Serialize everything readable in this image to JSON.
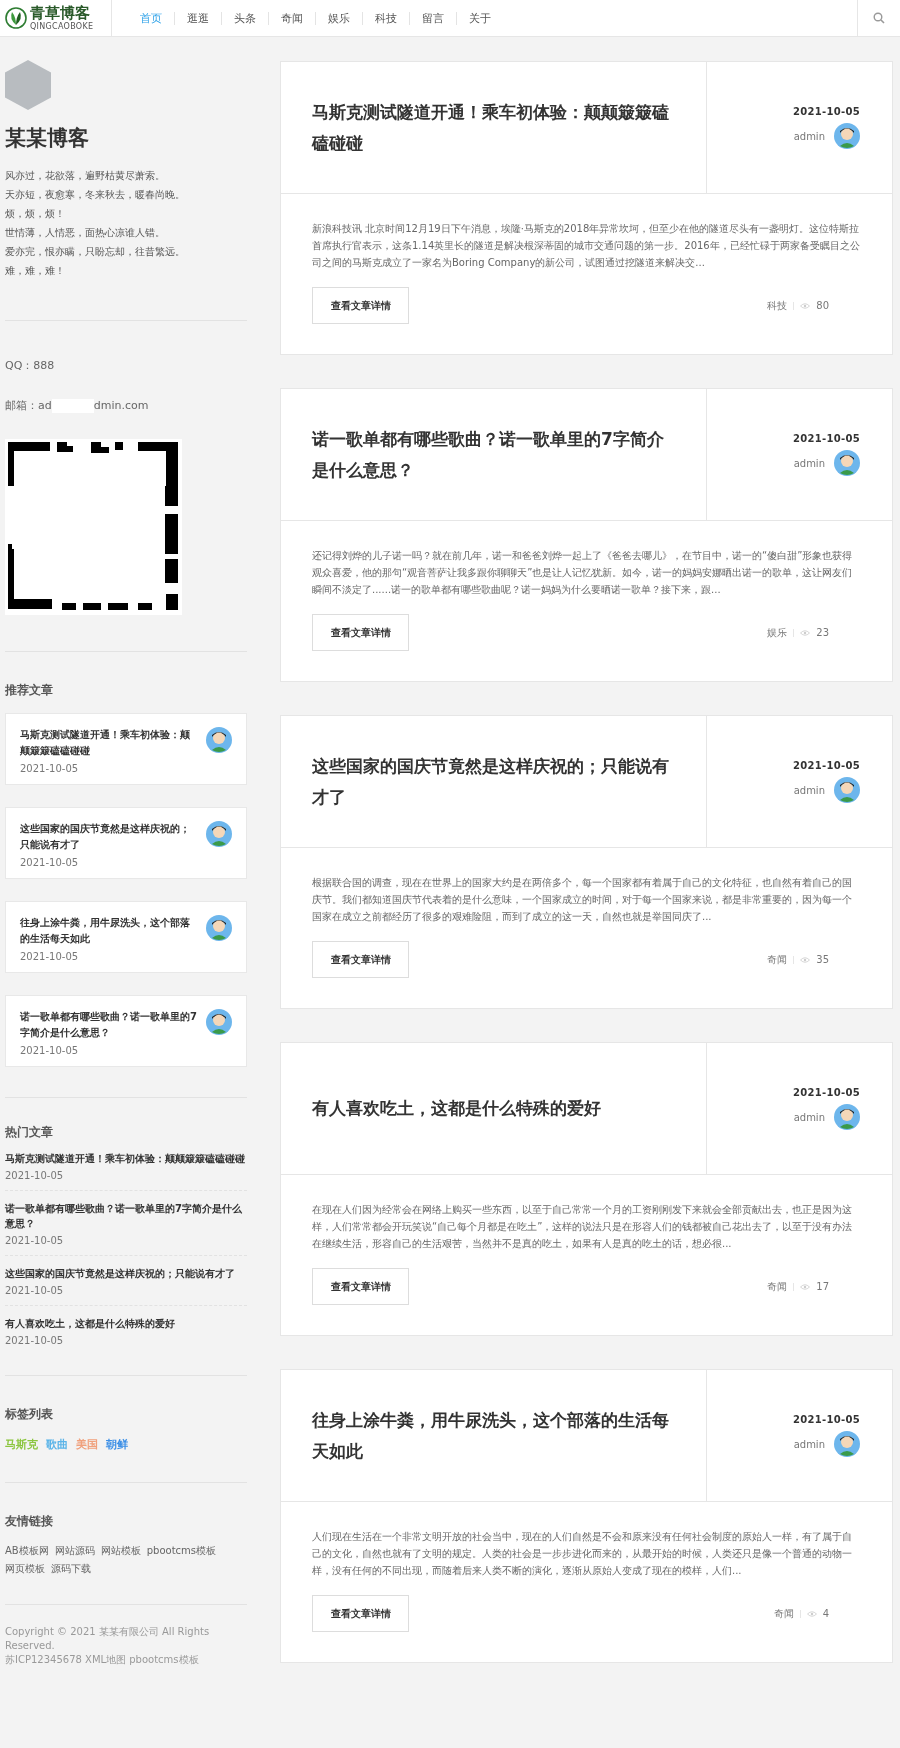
{
  "header": {
    "logo_text": "青草博客",
    "logo_sub": "QINGCAOBOKE",
    "nav": [
      {
        "label": "首页",
        "selected": true
      },
      {
        "label": "逛逛",
        "selected": false
      },
      {
        "label": "头条",
        "selected": false
      },
      {
        "label": "奇闻",
        "selected": false
      },
      {
        "label": "娱乐",
        "selected": false
      },
      {
        "label": "科技",
        "selected": false
      },
      {
        "label": "留言",
        "selected": false
      },
      {
        "label": "关于",
        "selected": false
      }
    ]
  },
  "sidebar": {
    "blog_title": "某某博客",
    "bio": [
      "风亦过，花欲落，遍野枯黄尽萧索。",
      "天亦短，夜愈寒，冬来秋去，暖春尚晚。",
      "烦，烦，烦！",
      "世情薄，人情恶，面热心凉谁人错。",
      "爱亦完，恨亦瞒，只盼忘却，往昔繁远。",
      "难，难，难！"
    ],
    "qq": "QQ：888",
    "email": [
      "邮箱：ad",
      "dmin.com"
    ],
    "recommended": {
      "heading": "推荐文章",
      "items": [
        {
          "title": "马斯克测试隧道开通！乘车初体验：颠颠簸簸磕磕碰碰",
          "date": "2021-10-05"
        },
        {
          "title": "这些国家的国庆节竟然是这样庆祝的；只能说有才了",
          "date": "2021-10-05"
        },
        {
          "title": "往身上涂牛粪，用牛尿洗头，这个部落的生活每天如此",
          "date": "2021-10-05"
        },
        {
          "title": "诺一歌单都有哪些歌曲？诺一歌单里的7字简介是什么意思？",
          "date": "2021-10-05"
        }
      ]
    },
    "hot": {
      "heading": "热门文章",
      "items": [
        {
          "title": "马斯克测试隧道开通！乘车初体验：颠颠簸簸磕磕碰碰",
          "date": "2021-10-05"
        },
        {
          "title": "诺一歌单都有哪些歌曲？诺一歌单里的7字简介是什么意思？",
          "date": "2021-10-05"
        },
        {
          "title": "这些国家的国庆节竟然是这样庆祝的；只能说有才了",
          "date": "2021-10-05"
        },
        {
          "title": "有人喜欢吃土，这都是什么特殊的爱好",
          "date": "2021-10-05"
        }
      ]
    },
    "tags": {
      "heading": "标签列表",
      "items": [
        {
          "label": "马斯克",
          "color": "#8cc63f"
        },
        {
          "label": "歌曲",
          "color": "#5bb4e8"
        },
        {
          "label": "美国",
          "color": "#f0a07c"
        },
        {
          "label": "朝鲜",
          "color": "#3a8ee6"
        }
      ]
    },
    "links": {
      "heading": "友情链接",
      "items": [
        "AB模板网",
        "网站源码",
        "网站模板",
        "pbootcms模板",
        "网页模板",
        "源码下载"
      ]
    },
    "footer": [
      "Copyright © 2021 某某有限公司 All Rights Reserved.",
      "苏ICP12345678 XML地图 pbootcms模板"
    ]
  },
  "posts": [
    {
      "title": "马斯克测试隧道开通！乘车初体验：颠颠簸簸磕磕碰碰",
      "date": "2021-10-05",
      "author": "admin",
      "excerpt": "新浪科技讯 北京时间12月19日下午消息，埃隆·马斯克的2018年异常坎坷，但至少在他的隧道尽头有一盏明灯。这位特斯拉首席执行官表示，这条1.14英里长的隧道是解决根深蒂固的城市交通问题的第一步。2016年，已经忙碌于两家备受瞩目之公司之间的马斯克成立了一家名为Boring Company的新公司，试图通过挖隧道来解决交...",
      "button": "查看文章详情",
      "category": "科技",
      "views": "80"
    },
    {
      "title": "诺一歌单都有哪些歌曲？诺一歌单里的7字简介是什么意思？",
      "date": "2021-10-05",
      "author": "admin",
      "excerpt": "还记得刘烨的儿子诺一吗？就在前几年，诺一和爸爸刘烨一起上了《爸爸去哪儿》，在节目中，诺一的“傻白甜”形象也获得观众喜爱，他的那句“观音菩萨让我多跟你聊聊天”也是让人记忆犹新。如今，诺一的妈妈安娜晒出诺一的歌单，这让网友们瞬间不淡定了......诺一的歌单都有哪些歌曲呢？诺一妈妈为什么要晒诺一歌单？接下来，跟...",
      "button": "查看文章详情",
      "category": "娱乐",
      "views": "23"
    },
    {
      "title": "这些国家的国庆节竟然是这样庆祝的；只能说有才了",
      "date": "2021-10-05",
      "author": "admin",
      "excerpt": "根据联合国的调查，现在在世界上的国家大约是在两倍多个，每一个国家都有着属于自己的文化特征，也自然有着自己的国庆节。我们都知道国庆节代表着的是什么意味，一个国家成立的时间，对于每一个国家来说，都是非常重要的，因为每一个国家在成立之前都经历了很多的艰难险阻，而到了成立的这一天，自然也就是举国同庆了...",
      "button": "查看文章详情",
      "category": "奇闻",
      "views": "35"
    },
    {
      "title": "有人喜欢吃土，这都是什么特殊的爱好",
      "date": "2021-10-05",
      "author": "admin",
      "excerpt": "在现在人们因为经常会在网络上购买一些东西，以至于自己常常一个月的工资刚刚发下来就会全部贡献出去，也正是因为这样，人们常常都会开玩笑说“自己每个月都是在吃土”，这样的说法只是在形容人们的钱都被自己花出去了，以至于没有办法在继续生活，形容自己的生活艰苦，当然并不是真的吃土，如果有人是真的吃土的话，想必很...",
      "button": "查看文章详情",
      "category": "奇闻",
      "views": "17"
    },
    {
      "title": "往身上涂牛粪，用牛尿洗头，这个部落的生活每天如此",
      "date": "2021-10-05",
      "author": "admin",
      "excerpt": "人们现在生活在一个非常文明开放的社会当中，现在的人们自然是不会和原来没有任何社会制度的原始人一样，有了属于自己的文化，自然也就有了文明的规定。人类的社会是一步步进化而来的，从最开始的时候，人类还只是像一个普通的动物一样，没有任何的不同出现，而随着后来人类不断的演化，逐渐从原始人变成了现在的模样，人们...",
      "button": "查看文章详情",
      "category": "奇闻",
      "views": "4"
    }
  ]
}
